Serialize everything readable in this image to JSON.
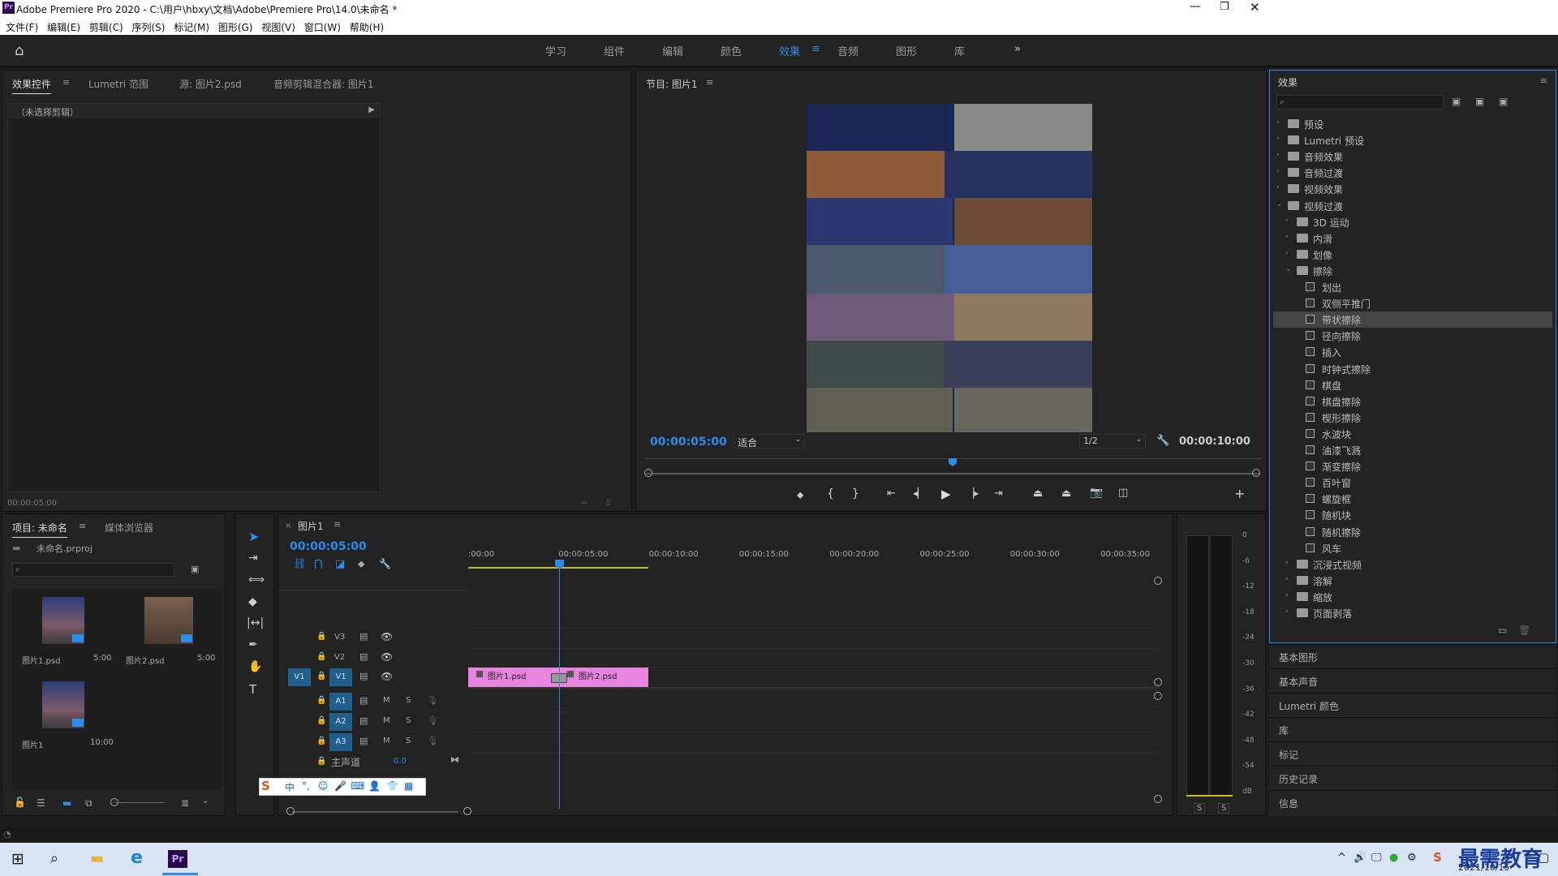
{
  "window": {
    "title": "Adobe Premiere Pro 2020 - C:\\用户\\hbxy\\文档\\Adobe\\Premiere Pro\\14.0\\未命名 *",
    "app_icon": "Pr"
  },
  "menu": [
    "文件(F)",
    "编辑(E)",
    "剪辑(C)",
    "序列(S)",
    "标记(M)",
    "图形(G)",
    "视图(V)",
    "窗口(W)",
    "帮助(H)"
  ],
  "workspaces": [
    "学习",
    "组件",
    "编辑",
    "颜色",
    "效果",
    "音频",
    "图形",
    "库"
  ],
  "source_panel": {
    "tabs": [
      "效果控件",
      "Lumetri 范围",
      "源: 图片2.psd",
      "音频剪辑混合器: 图片1"
    ],
    "no_clip": "（未选择剪辑）",
    "timecode": "00:00:05:00"
  },
  "program_monitor": {
    "title": "节目: 图片1",
    "timecode": "00:00:05:00",
    "fit": "适合",
    "resolution": "1/2",
    "duration": "00:00:10:00",
    "playhead_fraction": 0.5
  },
  "project_panel": {
    "tabs": [
      "项目: 未命名",
      "媒体浏览器"
    ],
    "project_file": "未命名.prproj",
    "items": [
      {
        "name": "图片1.psd",
        "duration": "5:00"
      },
      {
        "name": "图片2.psd",
        "duration": "5:00"
      },
      {
        "name": "图片1",
        "duration": "10:00"
      }
    ]
  },
  "timeline": {
    "title": "图片1",
    "timecode": "00:00:05:00",
    "ruler": [
      ":00:00",
      "00:00:05:00",
      "00:00:10:00",
      "00:00:15:00",
      "00:00:20:00",
      "00:00:25:00",
      "00:00:30:00",
      "00:00:35:00"
    ],
    "video_tracks": [
      "V3",
      "V2",
      "V1"
    ],
    "audio_tracks": [
      "A1",
      "A2",
      "A3"
    ],
    "source_patch": "V1",
    "master_label": "主声道",
    "master_value": "0.0",
    "clips": [
      "图片1.psd",
      "图片2.psd"
    ]
  },
  "audio_meter": {
    "ticks": [
      "0",
      "-6",
      "-12",
      "-18",
      "-24",
      "-30",
      "-36",
      "-42",
      "-48",
      "-54",
      "dB"
    ],
    "solo": [
      "S",
      "S"
    ]
  },
  "effects_panel": {
    "title": "效果",
    "tree": [
      {
        "label": "预设",
        "level": 0,
        "type": "folder",
        "expanded": false
      },
      {
        "label": "Lumetri 预设",
        "level": 0,
        "type": "folder",
        "expanded": false
      },
      {
        "label": "音频效果",
        "level": 0,
        "type": "folder",
        "expanded": false
      },
      {
        "label": "音频过渡",
        "level": 0,
        "type": "folder",
        "expanded": false
      },
      {
        "label": "视频效果",
        "level": 0,
        "type": "folder",
        "expanded": false
      },
      {
        "label": "视频过渡",
        "level": 0,
        "type": "folder",
        "expanded": true
      },
      {
        "label": "3D 运动",
        "level": 1,
        "type": "folder",
        "expanded": false
      },
      {
        "label": "内滑",
        "level": 1,
        "type": "folder",
        "expanded": false
      },
      {
        "label": "划像",
        "level": 1,
        "type": "folder",
        "expanded": false
      },
      {
        "label": "擦除",
        "level": 1,
        "type": "folder",
        "expanded": true
      },
      {
        "label": "划出",
        "level": 2,
        "type": "effect"
      },
      {
        "label": "双侧平推门",
        "level": 2,
        "type": "effect"
      },
      {
        "label": "带状擦除",
        "level": 2,
        "type": "effect",
        "selected": true
      },
      {
        "label": "径向擦除",
        "level": 2,
        "type": "effect"
      },
      {
        "label": "插入",
        "level": 2,
        "type": "effect"
      },
      {
        "label": "时钟式擦除",
        "level": 2,
        "type": "effect"
      },
      {
        "label": "棋盘",
        "level": 2,
        "type": "effect"
      },
      {
        "label": "棋盘擦除",
        "level": 2,
        "type": "effect"
      },
      {
        "label": "楔形擦除",
        "level": 2,
        "type": "effect"
      },
      {
        "label": "水波块",
        "level": 2,
        "type": "effect"
      },
      {
        "label": "油漆飞溅",
        "level": 2,
        "type": "effect"
      },
      {
        "label": "渐变擦除",
        "level": 2,
        "type": "effect"
      },
      {
        "label": "百叶窗",
        "level": 2,
        "type": "effect"
      },
      {
        "label": "螺旋框",
        "level": 2,
        "type": "effect"
      },
      {
        "label": "随机块",
        "level": 2,
        "type": "effect"
      },
      {
        "label": "随机擦除",
        "level": 2,
        "type": "effect"
      },
      {
        "label": "风车",
        "level": 2,
        "type": "effect"
      },
      {
        "label": "沉浸式视频",
        "level": 1,
        "type": "folder",
        "expanded": false
      },
      {
        "label": "溶解",
        "level": 1,
        "type": "folder",
        "expanded": false
      },
      {
        "label": "缩放",
        "level": 1,
        "type": "folder",
        "expanded": false
      },
      {
        "label": "页面剥落",
        "level": 1,
        "type": "folder",
        "expanded": false
      }
    ],
    "side_panels": [
      "基本图形",
      "基本声音",
      "Lumetri 颜色",
      "库",
      "标记",
      "历史记录",
      "信息"
    ]
  },
  "ime_toolbar": "中",
  "taskbar": {
    "date": "2021/10/15",
    "watermark": "最需教育"
  },
  "colors": {
    "accent": "#2d8ceb",
    "clip": "#e883e0",
    "track_patch": "#1f5f8c"
  }
}
